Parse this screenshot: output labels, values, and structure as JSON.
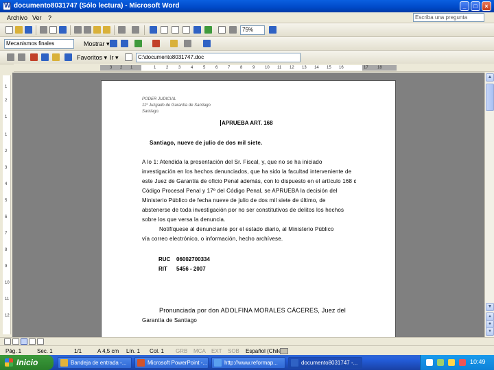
{
  "window": {
    "title": "documento8031747 (Sólo lectura) - Microsoft Word",
    "buttons": [
      "minimize",
      "maximize",
      "close"
    ]
  },
  "menubar": {
    "items": [
      "Archivo",
      "Ver",
      "?"
    ],
    "ask_placeholder": "Escriba una pregunta"
  },
  "toolbar1": {
    "zoom": "75%"
  },
  "toolbar2": {
    "style_combo": "Mecanismos finales",
    "mostrar_label": "Mostrar ▾"
  },
  "toolbar3": {
    "favoritos_label": "Favoritos ▾",
    "ir_label": "Ir ▾",
    "address": "C:\\documento8031747.doc"
  },
  "hruler": {
    "ticks": [
      "3",
      "2",
      "1",
      "1",
      "2",
      "3",
      "4",
      "5",
      "6",
      "7",
      "8",
      "9",
      "10",
      "11",
      "12",
      "13",
      "14",
      "15",
      "16",
      "17",
      "18"
    ]
  },
  "vruler": {
    "ticks": [
      "1",
      "2",
      "1",
      "1",
      "2",
      "3",
      "4",
      "5",
      "6",
      "7",
      "8",
      "9",
      "10",
      "11",
      "12"
    ]
  },
  "document": {
    "header": [
      "PODER JUDICIAL",
      "11º Juzgado de Garantía de Santiago",
      "Santiago."
    ],
    "title": "APRUEBA ART. 168",
    "date_line": "Santiago, nueve de julio de dos mil siete.",
    "paragraph1": [
      "A lo 1: Atendida la presentación del Sr. Fiscal, y, que no se ha iniciado",
      "investigación en los hechos denunciados, que ha sido la facultad interveniente de",
      "este Juez de Garantía de oficio Penal además, con lo dispuesto en el artículo 168 del",
      "Código Procesal Penal y 17º del Código Penal, se APRUEBA la decisión del",
      "Ministerio Público de fecha nueve de julio de dos mil siete de último, de",
      "abstenerse de toda investigación por no ser constitutivos de delitos los hechos",
      "sobre los que versa la denuncia."
    ],
    "paragraph2": [
      "Notifíquese al denunciante por el estado diario, al Ministerio Público",
      "vía correo electrónico, o información, hecho archívese."
    ],
    "ruc": {
      "label": "RUC",
      "value": "06002700334"
    },
    "rit": {
      "label": "RIT",
      "value": "5456 - 2007"
    },
    "footer": [
      "Pronunciada por don ADOLFINA MORALES CÁCERES, Juez del",
      "Garantía de Santiago"
    ]
  },
  "statusbar": {
    "page": "Pág. 1",
    "section": "Sec. 1",
    "pages": "1/1",
    "at": "A 4,5 cm",
    "line": "Lín. 1",
    "col": "Col. 1",
    "grb": "GRB",
    "mca": "MCA",
    "ext": "EXT",
    "sob": "SOB",
    "lang": "Español (Chile)"
  },
  "taskbar": {
    "start": "Inicio",
    "tasks": [
      "Bandeja de entrada -...",
      "Microsoft PowerPoint -...",
      "http://www.reformap...",
      "documento8031747 -..."
    ],
    "clock": "10:49"
  }
}
